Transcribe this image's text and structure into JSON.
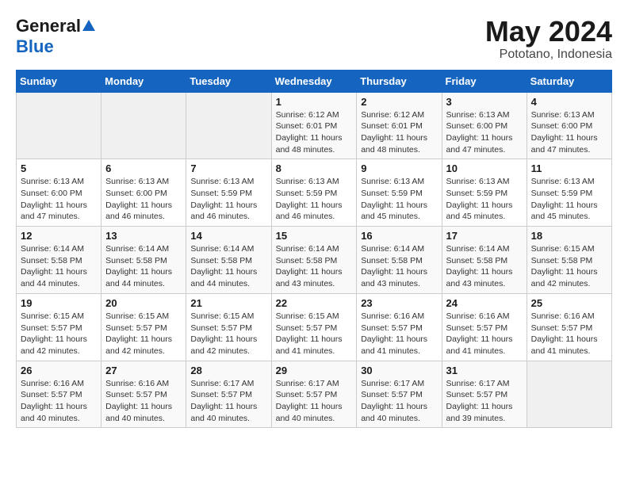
{
  "header": {
    "logo_general": "General",
    "logo_blue": "Blue",
    "month_title": "May 2024",
    "location": "Pototano, Indonesia"
  },
  "days_of_week": [
    "Sunday",
    "Monday",
    "Tuesday",
    "Wednesday",
    "Thursday",
    "Friday",
    "Saturday"
  ],
  "weeks": [
    [
      {
        "num": "",
        "sunrise": "",
        "sunset": "",
        "daylight": ""
      },
      {
        "num": "",
        "sunrise": "",
        "sunset": "",
        "daylight": ""
      },
      {
        "num": "",
        "sunrise": "",
        "sunset": "",
        "daylight": ""
      },
      {
        "num": "1",
        "sunrise": "Sunrise: 6:12 AM",
        "sunset": "Sunset: 6:01 PM",
        "daylight": "Daylight: 11 hours and 48 minutes."
      },
      {
        "num": "2",
        "sunrise": "Sunrise: 6:12 AM",
        "sunset": "Sunset: 6:01 PM",
        "daylight": "Daylight: 11 hours and 48 minutes."
      },
      {
        "num": "3",
        "sunrise": "Sunrise: 6:13 AM",
        "sunset": "Sunset: 6:00 PM",
        "daylight": "Daylight: 11 hours and 47 minutes."
      },
      {
        "num": "4",
        "sunrise": "Sunrise: 6:13 AM",
        "sunset": "Sunset: 6:00 PM",
        "daylight": "Daylight: 11 hours and 47 minutes."
      }
    ],
    [
      {
        "num": "5",
        "sunrise": "Sunrise: 6:13 AM",
        "sunset": "Sunset: 6:00 PM",
        "daylight": "Daylight: 11 hours and 47 minutes."
      },
      {
        "num": "6",
        "sunrise": "Sunrise: 6:13 AM",
        "sunset": "Sunset: 6:00 PM",
        "daylight": "Daylight: 11 hours and 46 minutes."
      },
      {
        "num": "7",
        "sunrise": "Sunrise: 6:13 AM",
        "sunset": "Sunset: 5:59 PM",
        "daylight": "Daylight: 11 hours and 46 minutes."
      },
      {
        "num": "8",
        "sunrise": "Sunrise: 6:13 AM",
        "sunset": "Sunset: 5:59 PM",
        "daylight": "Daylight: 11 hours and 46 minutes."
      },
      {
        "num": "9",
        "sunrise": "Sunrise: 6:13 AM",
        "sunset": "Sunset: 5:59 PM",
        "daylight": "Daylight: 11 hours and 45 minutes."
      },
      {
        "num": "10",
        "sunrise": "Sunrise: 6:13 AM",
        "sunset": "Sunset: 5:59 PM",
        "daylight": "Daylight: 11 hours and 45 minutes."
      },
      {
        "num": "11",
        "sunrise": "Sunrise: 6:13 AM",
        "sunset": "Sunset: 5:59 PM",
        "daylight": "Daylight: 11 hours and 45 minutes."
      }
    ],
    [
      {
        "num": "12",
        "sunrise": "Sunrise: 6:14 AM",
        "sunset": "Sunset: 5:58 PM",
        "daylight": "Daylight: 11 hours and 44 minutes."
      },
      {
        "num": "13",
        "sunrise": "Sunrise: 6:14 AM",
        "sunset": "Sunset: 5:58 PM",
        "daylight": "Daylight: 11 hours and 44 minutes."
      },
      {
        "num": "14",
        "sunrise": "Sunrise: 6:14 AM",
        "sunset": "Sunset: 5:58 PM",
        "daylight": "Daylight: 11 hours and 44 minutes."
      },
      {
        "num": "15",
        "sunrise": "Sunrise: 6:14 AM",
        "sunset": "Sunset: 5:58 PM",
        "daylight": "Daylight: 11 hours and 43 minutes."
      },
      {
        "num": "16",
        "sunrise": "Sunrise: 6:14 AM",
        "sunset": "Sunset: 5:58 PM",
        "daylight": "Daylight: 11 hours and 43 minutes."
      },
      {
        "num": "17",
        "sunrise": "Sunrise: 6:14 AM",
        "sunset": "Sunset: 5:58 PM",
        "daylight": "Daylight: 11 hours and 43 minutes."
      },
      {
        "num": "18",
        "sunrise": "Sunrise: 6:15 AM",
        "sunset": "Sunset: 5:58 PM",
        "daylight": "Daylight: 11 hours and 42 minutes."
      }
    ],
    [
      {
        "num": "19",
        "sunrise": "Sunrise: 6:15 AM",
        "sunset": "Sunset: 5:57 PM",
        "daylight": "Daylight: 11 hours and 42 minutes."
      },
      {
        "num": "20",
        "sunrise": "Sunrise: 6:15 AM",
        "sunset": "Sunset: 5:57 PM",
        "daylight": "Daylight: 11 hours and 42 minutes."
      },
      {
        "num": "21",
        "sunrise": "Sunrise: 6:15 AM",
        "sunset": "Sunset: 5:57 PM",
        "daylight": "Daylight: 11 hours and 42 minutes."
      },
      {
        "num": "22",
        "sunrise": "Sunrise: 6:15 AM",
        "sunset": "Sunset: 5:57 PM",
        "daylight": "Daylight: 11 hours and 41 minutes."
      },
      {
        "num": "23",
        "sunrise": "Sunrise: 6:16 AM",
        "sunset": "Sunset: 5:57 PM",
        "daylight": "Daylight: 11 hours and 41 minutes."
      },
      {
        "num": "24",
        "sunrise": "Sunrise: 6:16 AM",
        "sunset": "Sunset: 5:57 PM",
        "daylight": "Daylight: 11 hours and 41 minutes."
      },
      {
        "num": "25",
        "sunrise": "Sunrise: 6:16 AM",
        "sunset": "Sunset: 5:57 PM",
        "daylight": "Daylight: 11 hours and 41 minutes."
      }
    ],
    [
      {
        "num": "26",
        "sunrise": "Sunrise: 6:16 AM",
        "sunset": "Sunset: 5:57 PM",
        "daylight": "Daylight: 11 hours and 40 minutes."
      },
      {
        "num": "27",
        "sunrise": "Sunrise: 6:16 AM",
        "sunset": "Sunset: 5:57 PM",
        "daylight": "Daylight: 11 hours and 40 minutes."
      },
      {
        "num": "28",
        "sunrise": "Sunrise: 6:17 AM",
        "sunset": "Sunset: 5:57 PM",
        "daylight": "Daylight: 11 hours and 40 minutes."
      },
      {
        "num": "29",
        "sunrise": "Sunrise: 6:17 AM",
        "sunset": "Sunset: 5:57 PM",
        "daylight": "Daylight: 11 hours and 40 minutes."
      },
      {
        "num": "30",
        "sunrise": "Sunrise: 6:17 AM",
        "sunset": "Sunset: 5:57 PM",
        "daylight": "Daylight: 11 hours and 40 minutes."
      },
      {
        "num": "31",
        "sunrise": "Sunrise: 6:17 AM",
        "sunset": "Sunset: 5:57 PM",
        "daylight": "Daylight: 11 hours and 39 minutes."
      },
      {
        "num": "",
        "sunrise": "",
        "sunset": "",
        "daylight": ""
      }
    ]
  ]
}
